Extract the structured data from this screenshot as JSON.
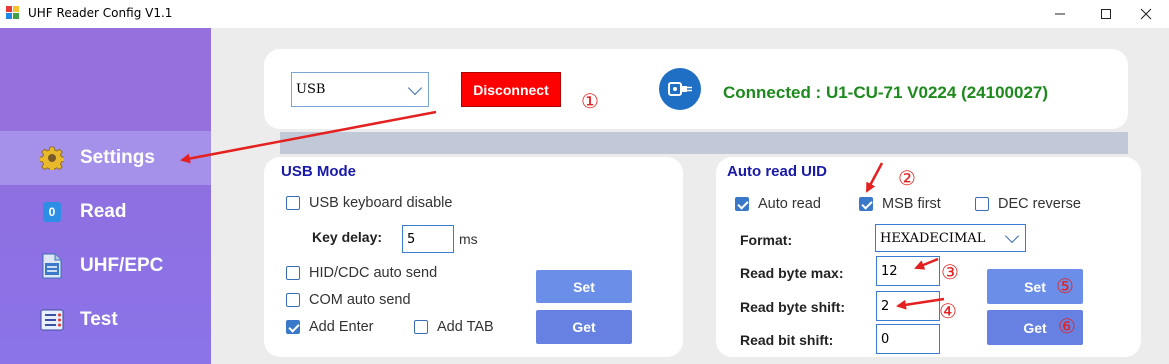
{
  "window": {
    "title": "UHF Reader Config V1.1",
    "minimize_icon": "minimize-icon",
    "maximize_icon": "maximize-icon",
    "close_icon": "close-icon"
  },
  "sidebar": {
    "items": [
      {
        "label": "Settings",
        "icon": "gear-icon",
        "active": true
      },
      {
        "label": "Read",
        "icon": "badge-zero-icon",
        "badge": "0"
      },
      {
        "label": "UHF/EPC",
        "icon": "document-binary-icon",
        "badge": "100\n001"
      },
      {
        "label": "Test",
        "icon": "checklist-icon"
      }
    ]
  },
  "connection": {
    "port_value": "USB",
    "disconnect_label": "Disconnect",
    "status_text": "Connected : U1-CU-71 V0224 (24100027)",
    "status_color": "#1c8a1c",
    "plug_icon": "usb-plug-icon"
  },
  "usb_mode": {
    "title": "USB Mode",
    "keyboard_disable": {
      "label": "USB keyboard disable",
      "checked": false
    },
    "key_delay_label": "Key delay:",
    "key_delay_value": "5",
    "key_delay_unit": "ms",
    "hid_cdc": {
      "label": "HID/CDC auto send",
      "checked": false
    },
    "com_auto": {
      "label": "COM auto send",
      "checked": false
    },
    "add_enter": {
      "label": "Add Enter",
      "checked": true
    },
    "add_tab": {
      "label": "Add TAB",
      "checked": false
    },
    "set_label": "Set",
    "get_label": "Get"
  },
  "auto_read": {
    "title": "Auto read UID",
    "auto_read": {
      "label": "Auto read",
      "checked": true
    },
    "msb_first": {
      "label": "MSB first",
      "checked": true
    },
    "dec_reverse": {
      "label": "DEC reverse",
      "checked": false
    },
    "format_label": "Format:",
    "format_value": "HEXADECIMAL",
    "read_byte_max_label": "Read byte max:",
    "read_byte_max_value": "12",
    "read_byte_shift_label": "Read byte shift:",
    "read_byte_shift_value": "2",
    "read_bit_shift_label": "Read bit shift:",
    "read_bit_shift_value": "0",
    "set_label": "Set",
    "get_label": "Get"
  },
  "annotations": {
    "n1": "①",
    "n2": "②",
    "n3": "③",
    "n4": "④",
    "n5": "⑤",
    "n6": "⑥",
    "color": "#e42020"
  },
  "colors": {
    "sidebar": "#9670dc",
    "sidebar_active": "#a590ea",
    "button_blue": "#6b8fe8",
    "disconnect_red": "#ff0000",
    "section_title": "#1a1aa8"
  }
}
